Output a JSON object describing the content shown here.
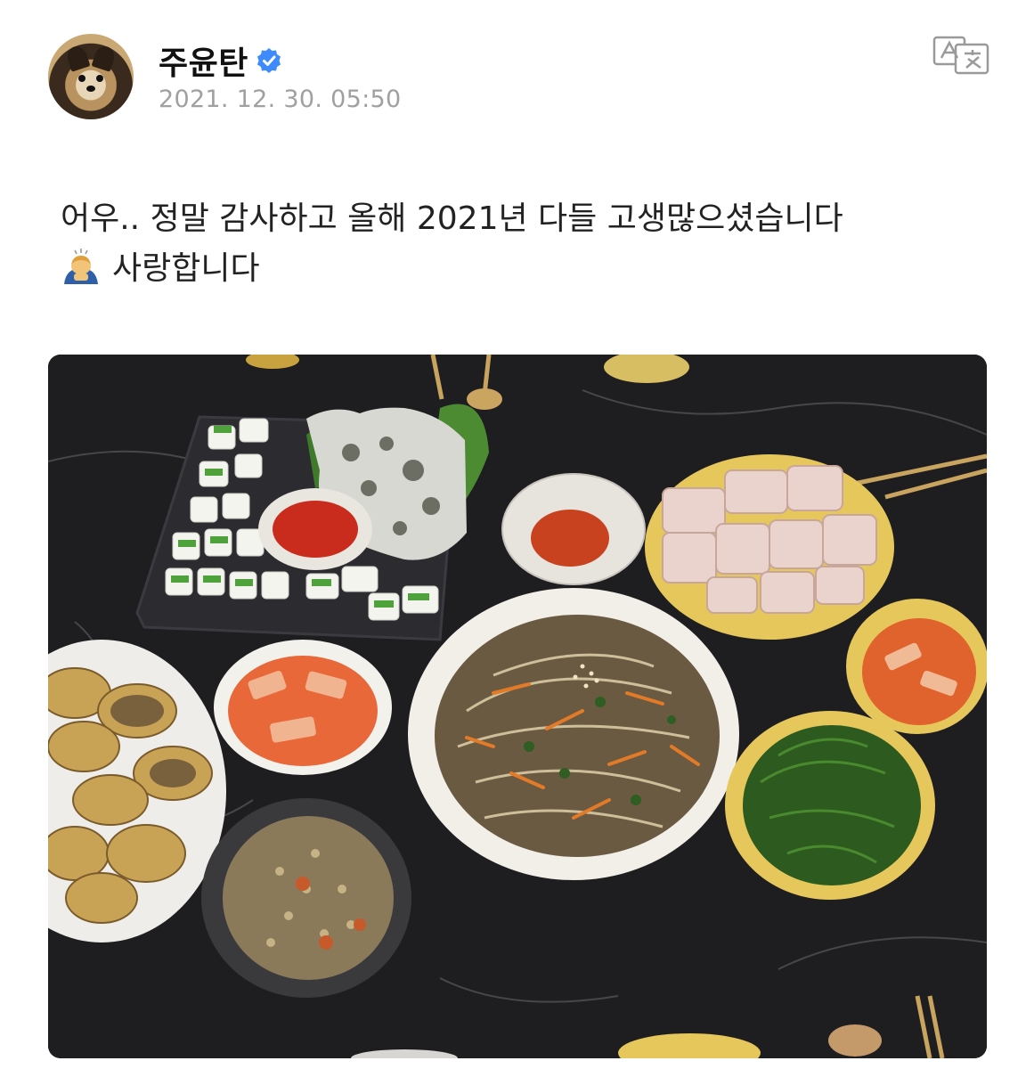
{
  "post": {
    "author": {
      "name": "주윤탄",
      "avatar_icon": "pomeranian-avatar",
      "verified_icon": "verified-badge-icon",
      "verified_color": "#3d8bfd"
    },
    "timestamp": "2021. 12. 30. 05:50",
    "translate_icon": "translate-icon",
    "text_line1": "어우.. 정말 감사하고 올해 2021년 다들 고생많으셨습니다",
    "text_line2": "사랑합니다",
    "emoji_icon": "person-bowing-emoji",
    "photo": {
      "subject": "food-spread-photo"
    }
  }
}
